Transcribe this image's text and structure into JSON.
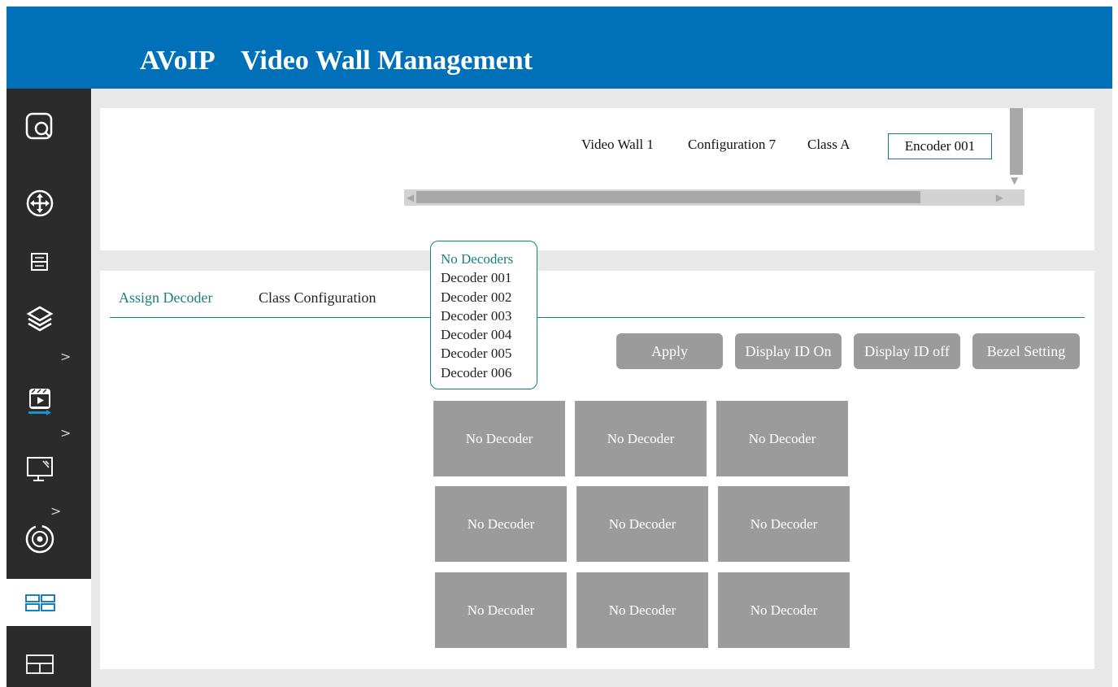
{
  "app": {
    "title": "AVoIP    Video Wall Management"
  },
  "sidebar": {
    "items": [
      {
        "name": "search-icon"
      },
      {
        "name": "move-arrows-icon"
      },
      {
        "name": "server-icon"
      },
      {
        "name": "layers-icon",
        "arrow": ">"
      },
      {
        "name": "media-icon",
        "arrow": ">"
      },
      {
        "name": "monitor-icon",
        "arrow": ">"
      },
      {
        "name": "target-icon"
      },
      {
        "name": "grid-two-icon",
        "active": true
      },
      {
        "name": "grid-four-icon"
      }
    ]
  },
  "wall": {
    "video_wall": "Video Wall 1",
    "configuration": "Configuration 7",
    "class": "Class A",
    "encoder": "Encoder 001"
  },
  "tabs": [
    {
      "label": "Assign Decoder",
      "active": true
    },
    {
      "label": "Class Configuration",
      "active": false
    }
  ],
  "decoder_dropdown": {
    "options": [
      "No Decoders",
      "Decoder 001",
      "Decoder 002",
      "Decoder 003",
      "Decoder 004",
      "Decoder 005",
      "Decoder 006"
    ],
    "selected": "No Decoders"
  },
  "toolbar": {
    "apply": "Apply",
    "display_id_on": "Display ID On",
    "display_id_off": "Display ID off",
    "bezel_setting": "Bezel Setting"
  },
  "grid": {
    "cells": [
      "No Decoder",
      "No Decoder",
      "No Decoder",
      "No Decoder",
      "No Decoder",
      "No Decoder",
      "No Decoder",
      "No Decoder",
      "No Decoder"
    ]
  },
  "colors": {
    "header": "#0070b8",
    "sidebar": "#2b2b2b",
    "accent": "#1a7f77",
    "cell": "#9b9b9b"
  }
}
